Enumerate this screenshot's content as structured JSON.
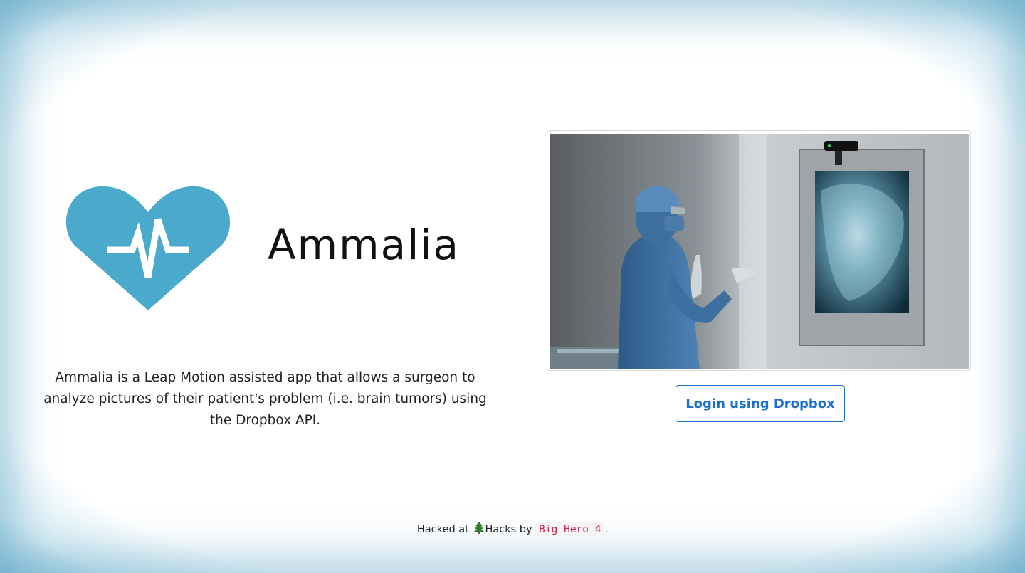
{
  "brand": {
    "name": "Ammalia",
    "logo_icon": "heart-pulse-icon",
    "logo_color": "#4ba9cc"
  },
  "description": "Ammalia is a Leap Motion assisted app that allows a surgeon to analyze pictures of their patient's problem (i.e. brain tumors) using the Dropbox API.",
  "hero_image": {
    "icon": "surgeon-with-xray-photo"
  },
  "login_button": {
    "label": "Login using Dropbox",
    "color": "#1a6fd0"
  },
  "footer": {
    "prefix": "Hacked at",
    "event_icon": "tree-icon",
    "event_name": "Hacks by",
    "team": "Big Hero 4",
    "suffix": "."
  }
}
